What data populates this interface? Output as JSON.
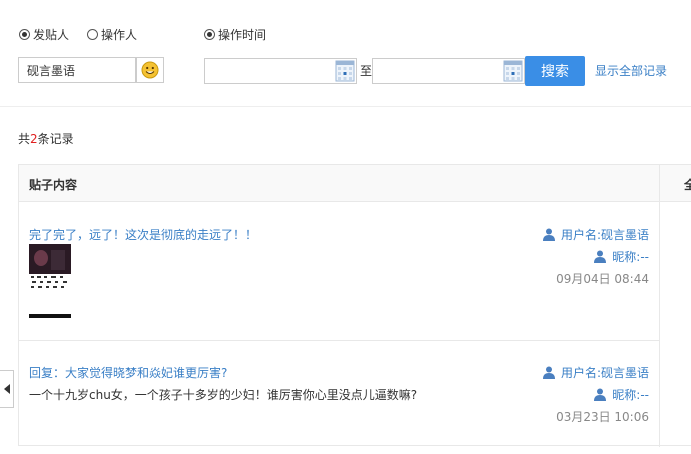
{
  "filters": {
    "radio_poster": "发贴人",
    "radio_operator": "操作人",
    "radio_time": "操作时间",
    "name_value": "砚言墨语",
    "date_from": "",
    "date_to": "",
    "to_label": "至",
    "search_label": "搜索",
    "show_all_label": "显示全部记录"
  },
  "summary": {
    "prefix": "共",
    "count": "2",
    "suffix": "条记录"
  },
  "table": {
    "col_content": "贴子内容",
    "col_second": "全"
  },
  "posts": [
    {
      "title": "完了完了，远了！这次是彻底的走远了！！",
      "body": "",
      "username_label": "用户名: ",
      "username": "砚言墨语",
      "nickname_label": "昵称: ",
      "nickname": "--",
      "date": "09月04日 08:44"
    },
    {
      "title": "回复：大家觉得晓梦和焱妃谁更厉害?",
      "body": "一个十九岁chu女，一个孩子十多岁的少妇！谁厉害你心里没点儿逼数嘛?",
      "username_label": "用户名: ",
      "username": "砚言墨语",
      "nickname_label": "昵称: ",
      "nickname": "--",
      "date": "03月23日 10:06"
    }
  ],
  "colors": {
    "accent": "#3a8ee6",
    "link": "#3a7fc6",
    "count_highlight": "#e02020"
  },
  "icons": [
    "smiley-icon",
    "calendar-icon",
    "user-icon",
    "chevron-left-icon"
  ]
}
